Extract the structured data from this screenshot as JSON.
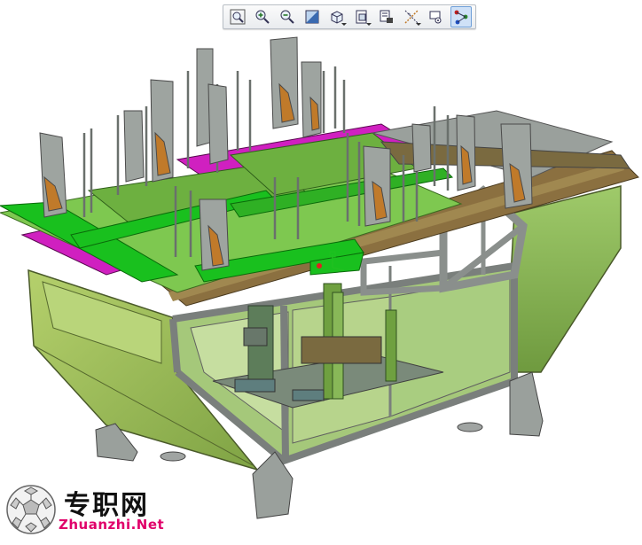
{
  "toolbar": {
    "buttons": [
      {
        "id": "zoom-fit",
        "icon": "zoom-fit-icon"
      },
      {
        "id": "zoom-in",
        "icon": "zoom-in-icon"
      },
      {
        "id": "zoom-out",
        "icon": "zoom-out-icon"
      },
      {
        "id": "shading",
        "icon": "shaded-display-icon"
      },
      {
        "id": "view-orient",
        "icon": "cube-view-icon"
      },
      {
        "id": "saved-views",
        "icon": "saved-views-icon"
      },
      {
        "id": "layers",
        "icon": "layers-icon"
      },
      {
        "id": "datum-display",
        "icon": "datum-display-icon"
      },
      {
        "id": "spin-center",
        "icon": "spin-center-icon"
      },
      {
        "id": "annotation",
        "icon": "annotation-icon"
      }
    ]
  },
  "model": {
    "description_icon": "cad-fixture-model"
  },
  "watermark": {
    "chinese": "专职网",
    "english": "Zhuanzhi.Net"
  },
  "colors": {
    "frame": "#8a8f8c",
    "panel_green": "#8db85a",
    "plate_green": "#7ec850",
    "bright_green": "#19c01e",
    "magenta": "#d020c0",
    "rail_brown": "#8b7040",
    "logo_pink": "#e0006a"
  }
}
